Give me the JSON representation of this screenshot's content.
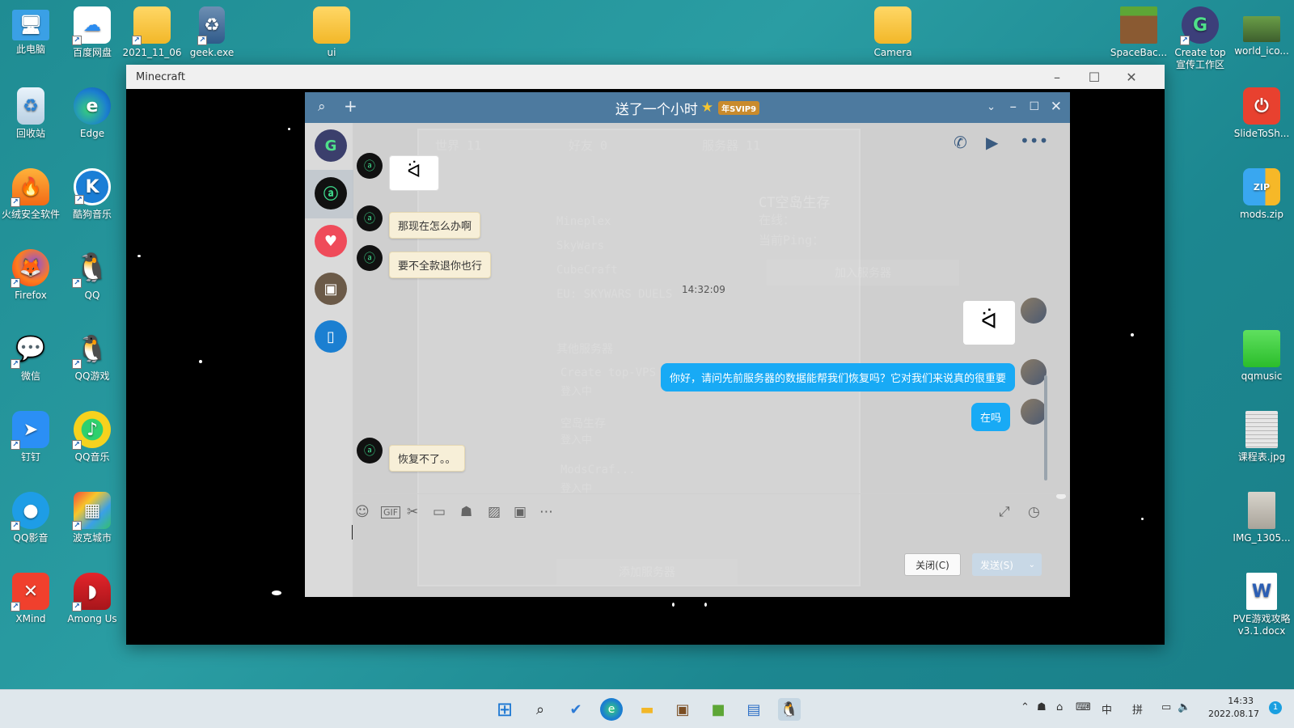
{
  "desktop": {
    "icons_left": [
      {
        "label": "此电脑",
        "icon": "computer-icon",
        "color": "#3aa0e6"
      },
      {
        "label": "百度网盘",
        "icon": "baidu-netdisk-icon",
        "color": "#ffffff"
      },
      {
        "label": "2021_11_06",
        "icon": "folder-icon"
      },
      {
        "label": "geek.exe",
        "icon": "recycle-exe-icon"
      },
      {
        "label": "ui",
        "icon": "folder-icon"
      },
      {
        "label": "回收站",
        "icon": "recycle-bin-icon"
      },
      {
        "label": "Edge",
        "icon": "edge-icon"
      },
      {
        "label": "火绒安全软件",
        "icon": "huorong-icon"
      },
      {
        "label": "酷狗音乐",
        "icon": "kugou-icon"
      },
      {
        "label": "Firefox",
        "icon": "firefox-icon"
      },
      {
        "label": "QQ",
        "icon": "qq-penguin-icon"
      },
      {
        "label": "微信",
        "icon": "wechat-icon"
      },
      {
        "label": "QQ游戏",
        "icon": "qq-game-icon"
      },
      {
        "label": "钉钉",
        "icon": "dingtalk-icon"
      },
      {
        "label": "QQ音乐",
        "icon": "qq-music-icon"
      },
      {
        "label": "QQ影音",
        "icon": "qq-player-icon"
      },
      {
        "label": "波克城市",
        "icon": "boke-icon"
      },
      {
        "label": "XMind",
        "icon": "xmind-icon"
      },
      {
        "label": "Among Us",
        "icon": "among-us-icon"
      }
    ],
    "icons_right": [
      {
        "label": "Camera",
        "icon": "folder-icon"
      },
      {
        "label": "SpaceBac...",
        "icon": "grass-block-icon"
      },
      {
        "label": "Create top 宣传工作区",
        "icon": "create-top-icon"
      },
      {
        "label": "world_ico...",
        "icon": "world-icon"
      },
      {
        "label": "SlideToSh...",
        "icon": "slide-to-shutdown-icon"
      },
      {
        "label": "mods.zip",
        "icon": "zip-icon"
      },
      {
        "label": "qqmusic",
        "icon": "folder-green-icon"
      },
      {
        "label": "课程表.jpg",
        "icon": "image-icon"
      },
      {
        "label": "IMG_1305...",
        "icon": "image-icon"
      },
      {
        "label": "PVE游戏攻略 v3.1.docx",
        "icon": "word-icon"
      }
    ]
  },
  "minecraft_window": {
    "title": "Minecraft",
    "background_panel": {
      "tabs": [
        "世界 11",
        "好友 0",
        "服务器 11"
      ],
      "server_title": "CT空岛生存",
      "online_label": "在线：",
      "ping_label": "当前Ping：",
      "join_label": "加入服务器",
      "servers": [
        "Mineplex",
        "SkyWars",
        "CubeCraft",
        "EU: SKYWARS DUELS"
      ],
      "other_servers_label": "其他服务器",
      "other_entries": [
        "Create top-VPS",
        "空岛生存",
        "ModsCraf..."
      ],
      "joining_label": "登入中",
      "add_server_label": "添加服务器"
    }
  },
  "qq_chat": {
    "title": "送了一个小时",
    "vip_badge": "年SVIP9",
    "messages_left": [
      {
        "text": "那现在怎么办啊"
      },
      {
        "text": "要不全款退你也行"
      },
      {
        "text": "恢复不了。。"
      }
    ],
    "timestamp": "14:32:09",
    "messages_right": [
      {
        "text": "你好，请问先前服务器的数据能帮我们恢复吗？它对我们来说真的很重要"
      },
      {
        "text": "在吗"
      }
    ],
    "close_button": "关闭(C)",
    "send_button": "发送(S)"
  },
  "taskbar": {
    "time": "14:33",
    "date": "2022.08.17",
    "ime_lang": "中",
    "ime_mode": "拼",
    "notification_count": "1"
  }
}
